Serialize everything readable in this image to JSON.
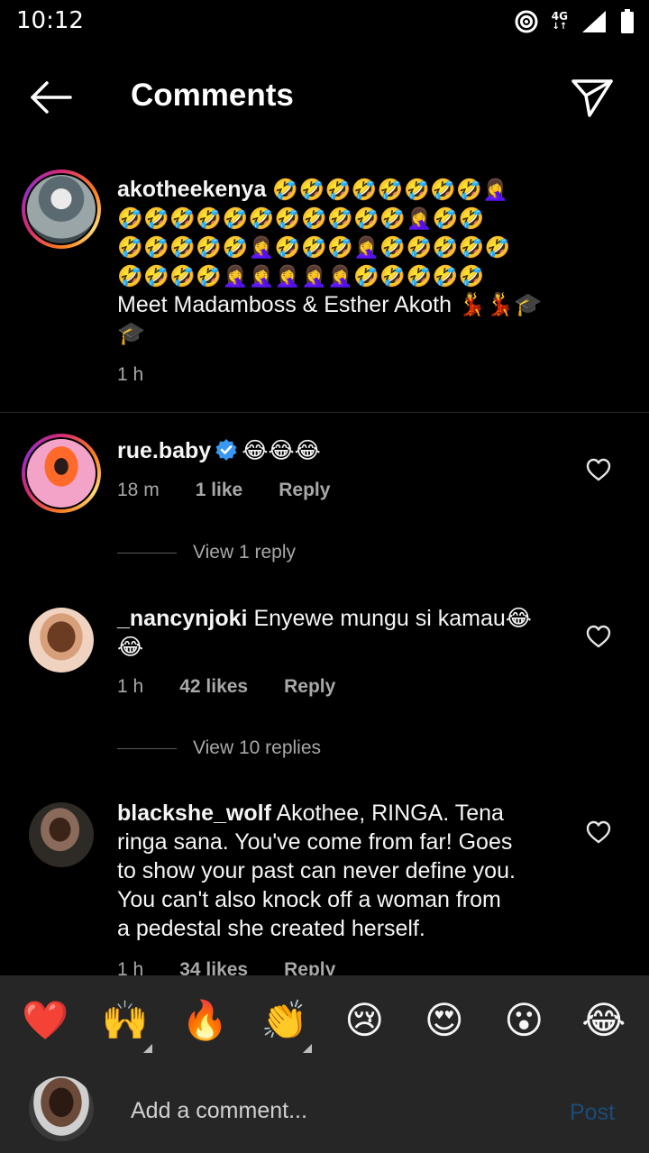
{
  "status": {
    "time": "10:12",
    "network": "4G"
  },
  "header": {
    "title": "Comments",
    "back_icon": "arrow-left-icon",
    "share_icon": "paper-plane-icon"
  },
  "caption": {
    "username": "akotheekenya",
    "emoji_line1": "🤣🤣🤣🤣🤣🤣🤣🤣🤦‍♀️",
    "emoji_line2": "🤣🤣🤣🤣🤣🤣🤣🤣🤣🤣🤣🤦‍♀️🤣🤣",
    "emoji_line3": "🤣🤣🤣🤣🤣🤦‍♀️🤣🤣🤣🤦‍♀️🤣🤣🤣🤣🤣",
    "emoji_line4": "🤣🤣🤣🤣🤦‍♀️🤦‍♀️🤦‍♀️🤦‍♀️🤦‍♀️🤣🤣🤣🤣🤣",
    "text": "Meet Madamboss & Esther Akoth 💃💃🎓",
    "text_cont": "🎓",
    "time": "1 h"
  },
  "comments": [
    {
      "username": "rue.baby",
      "text": "😂😂😂",
      "time": "18 m",
      "likes": "1 like",
      "reply": "Reply",
      "view_replies": "View 1 reply"
    },
    {
      "username": "_nancynjoki",
      "text": "Enyewe mungu si kamau😂",
      "text_cont": "😂",
      "time": "1 h",
      "likes": "42 likes",
      "reply": "Reply",
      "view_replies": "View 10 replies"
    },
    {
      "username": "blackshe_wolf",
      "text": " Akothee, RINGA. Tena",
      "line2": "ringa sana. You've come from far! Goes",
      "line3": "to show your past can never define you.",
      "line4": "You can't also knock off a woman from",
      "line5": "a pedestal she created herself.",
      "time": "1 h",
      "likes": "34 likes",
      "reply": "Reply"
    }
  ],
  "reactions": [
    "❤️",
    "🙌",
    "🔥",
    "👏",
    "😢",
    "😍",
    "😮",
    "😂"
  ],
  "composer": {
    "placeholder": "Add a comment...",
    "post_label": "Post"
  },
  "colors": {
    "background": "#000000",
    "panel": "#262626",
    "muted": "#a8a8a8",
    "post_disabled": "#1b4c79",
    "verified": "#3897f0"
  }
}
